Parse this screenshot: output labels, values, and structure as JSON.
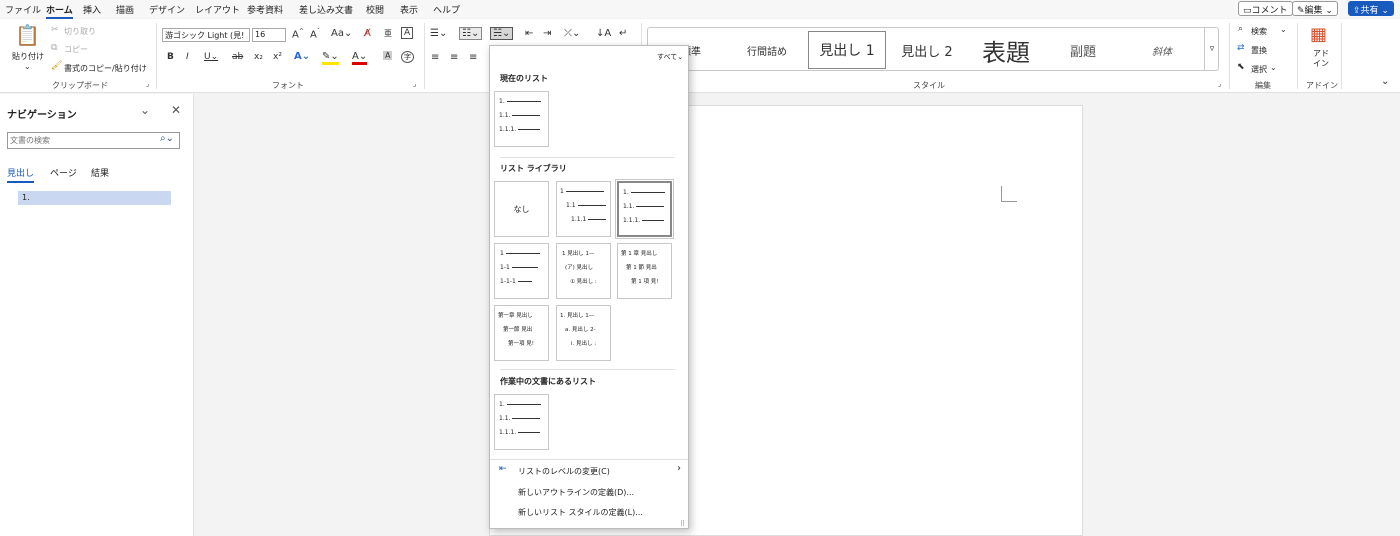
{
  "menubar": {
    "items": [
      "ファイル",
      "ホーム",
      "挿入",
      "描画",
      "デザイン",
      "レイアウト",
      "参考資料",
      "差し込み文書",
      "校閲",
      "表示",
      "ヘルプ"
    ],
    "comment_label": "コメント",
    "edit_label": "編集",
    "share_label": "共有"
  },
  "ribbon": {
    "clipboard": {
      "paste": "貼り付け",
      "cut": "切り取り",
      "copy": "コピー",
      "format_painter": "書式のコピー/貼り付け",
      "label": "クリップボード"
    },
    "font": {
      "font_name": "游ゴシック Light (見!",
      "font_size": "16",
      "label": "フォント"
    },
    "styles": {
      "items": [
        "標準",
        "行間詰め",
        "見出し 1",
        "見出し 2",
        "表題",
        "副題",
        "斜体"
      ],
      "label": "スタイル"
    },
    "editing": {
      "search": "検索",
      "replace": "置換",
      "select": "選択",
      "label": "編集"
    },
    "addins": {
      "button": "アド\nイン",
      "label": "アドイン"
    }
  },
  "nav": {
    "title": "ナビゲーション",
    "search_placeholder": "文書の検索",
    "tabs": [
      "見出し",
      "ページ",
      "結果"
    ],
    "heading_item": "1."
  },
  "dropdown": {
    "filter": "すべて",
    "current_list_heading": "現在のリスト",
    "library_heading": "リスト ライブラリ",
    "none_label": "なし",
    "doc_lists_heading": "作業中の文書にあるリスト",
    "thumbs": {
      "t_a": [
        "1.",
        "1.1.",
        "1.1.1."
      ],
      "t_b": [
        "1",
        "1.1",
        "1.1.1"
      ],
      "t_c": [
        "1",
        "1-1",
        "1-1-1"
      ],
      "t_d": [
        "1 見出し 1—",
        "(ア) 見出し",
        "① 見出し :"
      ],
      "t_e": [
        "第 1 章 見出し",
        "第 1 節 見出",
        "第 1 項 見!"
      ],
      "t_f": [
        "第一章 見出し",
        "第一節 見出",
        "第一項 見!"
      ],
      "t_g": [
        "1. 見出し 1—",
        "a. 見出し 2-",
        "i. 見出し :"
      ]
    },
    "commands": [
      "リストのレベルの変更(C)",
      "新しいアウトラインの定義(D)...",
      "新しいリスト スタイルの定義(L)..."
    ]
  }
}
